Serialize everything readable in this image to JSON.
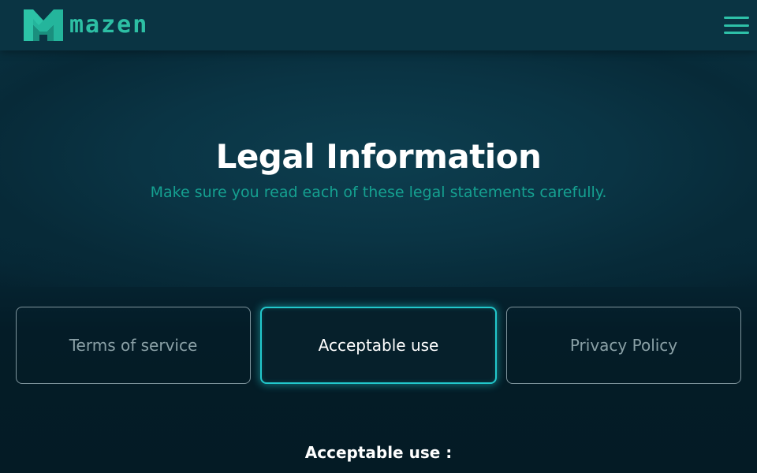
{
  "header": {
    "logo_text": "mazen",
    "logo_icon": "mazen-logo-icon",
    "menu_icon": "hamburger-menu-icon"
  },
  "hero": {
    "title": "Legal Information",
    "subtitle": "Make sure you read each of these legal statements carefully."
  },
  "tabs": [
    {
      "label": "Terms of service",
      "active": false
    },
    {
      "label": "Acceptable use",
      "active": true
    },
    {
      "label": "Privacy Policy",
      "active": false
    }
  ],
  "content": {
    "heading": "Acceptable use :"
  },
  "colors": {
    "background": "#061c27",
    "header": "#0a3443",
    "accent_teal": "#2dbfa4",
    "subtitle_teal": "#15a090",
    "active_glow": "#22c8cc",
    "inactive_text": "#8aa0a6"
  }
}
